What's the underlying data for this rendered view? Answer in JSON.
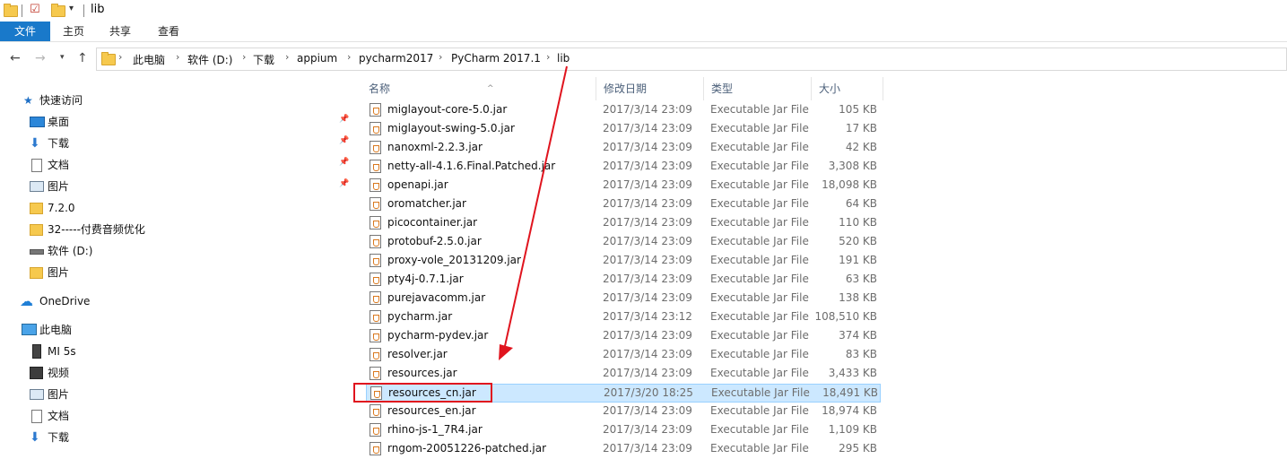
{
  "window": {
    "title": "lib"
  },
  "ribbon": {
    "tabs": [
      "文件",
      "主页",
      "共享",
      "查看"
    ]
  },
  "address": {
    "crumbs": [
      "此电脑",
      "软件 (D:)",
      "下载",
      "appium",
      "pycharm2017",
      "PyCharm 2017.1",
      "lib"
    ]
  },
  "sidebar": {
    "items": [
      {
        "label": "快速访问",
        "icon": "star-icon",
        "pinned": false,
        "indent": 0
      },
      {
        "label": "桌面",
        "icon": "desktop-icon",
        "pinned": true,
        "indent": 1
      },
      {
        "label": "下载",
        "icon": "download-icon",
        "pinned": true,
        "indent": 1
      },
      {
        "label": "文档",
        "icon": "document-icon",
        "pinned": true,
        "indent": 1
      },
      {
        "label": "图片",
        "icon": "pictures-icon",
        "pinned": true,
        "indent": 1
      },
      {
        "label": "7.2.0",
        "icon": "folder-icon",
        "pinned": false,
        "indent": 1
      },
      {
        "label": "32-----付费音频优化",
        "icon": "folder-icon",
        "pinned": false,
        "indent": 1
      },
      {
        "label": "软件 (D:)",
        "icon": "drive-icon",
        "pinned": false,
        "indent": 1
      },
      {
        "label": "图片",
        "icon": "folder-icon",
        "pinned": false,
        "indent": 1
      },
      {
        "label": "OneDrive",
        "icon": "cloud-icon",
        "pinned": false,
        "indent": 0
      },
      {
        "label": "此电脑",
        "icon": "computer-icon",
        "pinned": false,
        "indent": 0
      },
      {
        "label": "MI 5s",
        "icon": "phone-icon",
        "pinned": false,
        "indent": 1
      },
      {
        "label": "视频",
        "icon": "video-icon",
        "pinned": false,
        "indent": 1
      },
      {
        "label": "图片",
        "icon": "pictures-icon",
        "pinned": false,
        "indent": 1
      },
      {
        "label": "文档",
        "icon": "document-icon",
        "pinned": false,
        "indent": 1
      },
      {
        "label": "下载",
        "icon": "download-icon",
        "pinned": false,
        "indent": 1
      }
    ]
  },
  "columns": {
    "name": "名称",
    "date": "修改日期",
    "type": "类型",
    "size": "大小"
  },
  "files": [
    {
      "name": "miglayout-core-5.0.jar",
      "date": "2017/3/14 23:09",
      "type": "Executable Jar File",
      "size": "105 KB"
    },
    {
      "name": "miglayout-swing-5.0.jar",
      "date": "2017/3/14 23:09",
      "type": "Executable Jar File",
      "size": "17 KB"
    },
    {
      "name": "nanoxml-2.2.3.jar",
      "date": "2017/3/14 23:09",
      "type": "Executable Jar File",
      "size": "42 KB"
    },
    {
      "name": "netty-all-4.1.6.Final.Patched.jar",
      "date": "2017/3/14 23:09",
      "type": "Executable Jar File",
      "size": "3,308 KB"
    },
    {
      "name": "openapi.jar",
      "date": "2017/3/14 23:09",
      "type": "Executable Jar File",
      "size": "18,098 KB"
    },
    {
      "name": "oromatcher.jar",
      "date": "2017/3/14 23:09",
      "type": "Executable Jar File",
      "size": "64 KB"
    },
    {
      "name": "picocontainer.jar",
      "date": "2017/3/14 23:09",
      "type": "Executable Jar File",
      "size": "110 KB"
    },
    {
      "name": "protobuf-2.5.0.jar",
      "date": "2017/3/14 23:09",
      "type": "Executable Jar File",
      "size": "520 KB"
    },
    {
      "name": "proxy-vole_20131209.jar",
      "date": "2017/3/14 23:09",
      "type": "Executable Jar File",
      "size": "191 KB"
    },
    {
      "name": "pty4j-0.7.1.jar",
      "date": "2017/3/14 23:09",
      "type": "Executable Jar File",
      "size": "63 KB"
    },
    {
      "name": "purejavacomm.jar",
      "date": "2017/3/14 23:09",
      "type": "Executable Jar File",
      "size": "138 KB"
    },
    {
      "name": "pycharm.jar",
      "date": "2017/3/14 23:12",
      "type": "Executable Jar File",
      "size": "108,510 KB"
    },
    {
      "name": "pycharm-pydev.jar",
      "date": "2017/3/14 23:09",
      "type": "Executable Jar File",
      "size": "374 KB"
    },
    {
      "name": "resolver.jar",
      "date": "2017/3/14 23:09",
      "type": "Executable Jar File",
      "size": "83 KB"
    },
    {
      "name": "resources.jar",
      "date": "2017/3/14 23:09",
      "type": "Executable Jar File",
      "size": "3,433 KB"
    },
    {
      "name": "resources_cn.jar",
      "date": "2017/3/20 18:25",
      "type": "Executable Jar File",
      "size": "18,491 KB",
      "selected": true
    },
    {
      "name": "resources_en.jar",
      "date": "2017/3/14 23:09",
      "type": "Executable Jar File",
      "size": "18,974 KB"
    },
    {
      "name": "rhino-js-1_7R4.jar",
      "date": "2017/3/14 23:09",
      "type": "Executable Jar File",
      "size": "1,109 KB"
    },
    {
      "name": "rngom-20051226-patched.jar",
      "date": "2017/3/14 23:09",
      "type": "Executable Jar File",
      "size": "295 KB"
    }
  ],
  "colors": {
    "accent": "#1979ca",
    "selection": "#cce8ff",
    "annotation": "#e0141e"
  }
}
